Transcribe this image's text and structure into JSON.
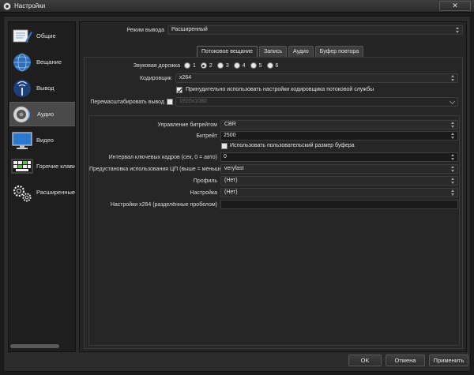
{
  "window": {
    "title": "Настройки",
    "close_symbol": "✕"
  },
  "sidebar": {
    "items": [
      {
        "label": "Общие",
        "icon": "general-icon"
      },
      {
        "label": "Вещание",
        "icon": "broadcast-icon"
      },
      {
        "label": "Вывод",
        "icon": "output-icon"
      },
      {
        "label": "Аудио",
        "icon": "audio-icon",
        "active": true
      },
      {
        "label": "Видео",
        "icon": "video-monitor-icon"
      },
      {
        "label": "Горячие клави",
        "icon": "keyboard-icon"
      },
      {
        "label": "Расширенные",
        "icon": "gears-icon"
      }
    ]
  },
  "output": {
    "mode_label": "Режим вывода",
    "mode_value": "Расширенный",
    "tabs": [
      "Потоковое вещание",
      "Запись",
      "Аудио",
      "Буфер повтора"
    ],
    "active_tab": "Потоковое вещание",
    "track_label": "Звуковая дорожка",
    "tracks": [
      "1",
      "2",
      "3",
      "4",
      "5",
      "6"
    ],
    "selected_track": "2",
    "encoder_label": "Кодировщик",
    "encoder_value": "x264",
    "enforce_label": "Принудительно использовать настройки кодировщика потоковой службы",
    "enforce_checked": true,
    "rescale_label": "Перемасштабировать вывод",
    "rescale_checked": false,
    "rescale_value": "1920x1080"
  },
  "encoder_settings": {
    "rate_control_label": "Управление битрейтом",
    "rate_control_value": "CBR",
    "bitrate_label": "Битрейт",
    "bitrate_value": "2500",
    "custom_buffer_label": "Использовать пользовательский размер буфера",
    "custom_buffer_checked": false,
    "keyframe_label": "Интервал ключевых кадров (сек, 0 = авто)",
    "keyframe_value": "0",
    "cpu_preset_label": "Предустановка использования ЦП (выше = меньше)",
    "cpu_preset_value": "veryfast",
    "profile_label": "Профиль",
    "profile_value": "(Нет)",
    "tune_label": "Настройка",
    "tune_value": "(Нет)",
    "x264_options_label": "Настройки x264 (разделённые пробелом)",
    "x264_options_value": ""
  },
  "buttons": {
    "ok": "OK",
    "cancel": "Отмена",
    "apply": "Применить"
  }
}
